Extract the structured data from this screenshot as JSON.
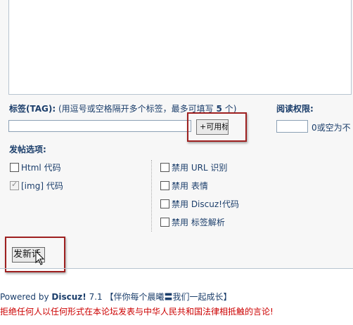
{
  "tags": {
    "label": "标签(TAG):",
    "hint_prefix": "(用逗号或空格隔开多个标签，最多可填写",
    "max_count": "5",
    "hint_suffix": "个)",
    "available_button": "+可用标"
  },
  "read_permission": {
    "label": "阅读权限:",
    "hint": "0或空为不"
  },
  "post_options": {
    "label": "发帖选项:",
    "left": [
      {
        "label": "Html 代码",
        "checked": false
      },
      {
        "label": "[img] 代码",
        "checked": true
      }
    ],
    "right": [
      {
        "label": "禁用 URL 识别",
        "checked": false
      },
      {
        "label": "禁用 表情",
        "checked": false
      },
      {
        "label": "禁用 Discuz!代码",
        "checked": false
      },
      {
        "label": "禁用 标签解析",
        "checked": false
      }
    ]
  },
  "submit_label": "发新话",
  "footer": {
    "powered_prefix": "Powered by",
    "brand": "Discuz!",
    "version": "7.1",
    "slogan": "【伴你每个晨曦〓我们一起成长】",
    "legal": "拒绝任何人以任何形式在本论坛发表与中华人民共和国法律相抵触的言论!"
  },
  "colors": {
    "label_blue": "#1b3e6b",
    "highlight_red": "#9e2020",
    "legal_red": "#cc0000"
  },
  "icons": [
    "mouse-pointer-icon",
    "checkmark-icon"
  ]
}
